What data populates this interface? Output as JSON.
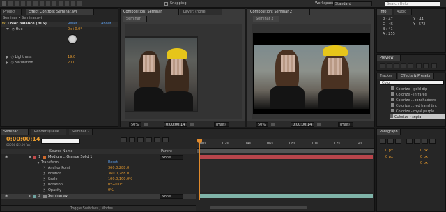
{
  "toolbar": {
    "snapping_label": "Snapping",
    "workspace_label": "Workspace:",
    "workspace_value": "Standard",
    "search_placeholder": "Search Help"
  },
  "effect_controls": {
    "tabs": [
      "Project",
      "Effect Controls: Seminar.avi"
    ],
    "breadcrumb": "Seminar • Seminar.avi",
    "effect_name": "Color Balance (HLS)",
    "reset_label": "Reset",
    "about_label": "About...",
    "hue_label": "Hue",
    "hue_value": "0x+0.0°",
    "lightness_label": "Lightness",
    "lightness_value": "19.0",
    "saturation_label": "Saturation",
    "saturation_value": "20.0"
  },
  "comp_left": {
    "tabs": [
      "Composition: Seminar",
      "Layer: (none)"
    ],
    "subtab": "Seminar",
    "zoom": "50%",
    "timecode": "0:00:00:14",
    "resolution": "(Half)"
  },
  "comp_right": {
    "tabs": [
      "Composition: Seminar 2"
    ],
    "subtab": "Seminar 2",
    "zoom": "50%",
    "timecode": "0:00:00:14",
    "resolution": "(Half)"
  },
  "info": {
    "tabs": [
      "Info",
      "Audio"
    ],
    "r": "R : 47",
    "g": "G : 45",
    "b": "B : 41",
    "a": "A : 255",
    "x": "X : 44",
    "y": "Y : 572"
  },
  "preview": {
    "tab": "Preview"
  },
  "effects_presets": {
    "tabs": [
      "Tracker",
      "Effects & Presets"
    ],
    "search_value": "Color",
    "items": [
      "Colorize - gold dip",
      "Colorize - infrared",
      "Colorize ...oonshadows",
      "Colorize ...red hand tint",
      "Colorize - royal purple",
      "Colorize - sepia"
    ]
  },
  "paragraph": {
    "tab": "Paragraph",
    "px1": "0 px",
    "px2": "0 px",
    "px3": "0 px",
    "px4": "0 px",
    "px5": "0 px"
  },
  "timeline": {
    "tabs": [
      "Seminar",
      "Render Queue",
      "Seminar 2"
    ],
    "timecode": "0:00:00:14",
    "frame_info": "00014 (25.00 fps)",
    "columns": {
      "source": "Source Name",
      "parent": "Parent"
    },
    "layers": [
      {
        "num": "1",
        "name": "Medium ...Orange Solid 1",
        "parent": "None"
      },
      {
        "num": "2",
        "name": "Seminar.avi",
        "parent": "None"
      }
    ],
    "transform_label": "Transform",
    "transform_reset": "Reset",
    "props": [
      {
        "name": "Anchor Point",
        "value": "360.0,288.0"
      },
      {
        "name": "Position",
        "value": "360.0,288.0"
      },
      {
        "name": "Scale",
        "value": "100.0,100.0%"
      },
      {
        "name": "Rotation",
        "value": "0x+0.0°"
      },
      {
        "name": "Opacity",
        "value": "0%"
      }
    ],
    "ruler": [
      "00s",
      "02s",
      "04s",
      "06s",
      "08s",
      "10s",
      "12s",
      "14s"
    ],
    "toggle_label": "Toggle Switches / Modes"
  },
  "colors": {
    "orange": "#e59a2e",
    "solid_bar": "#b8454b",
    "video_bar": "#7fb3a8",
    "playhead": "#e08a2c"
  }
}
